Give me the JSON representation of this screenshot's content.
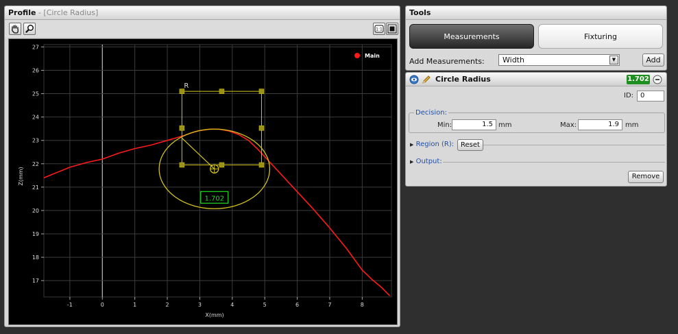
{
  "profile": {
    "title": "Profile",
    "subtitle": " - [Circle Radius]"
  },
  "chart_data": {
    "type": "line",
    "xlabel": "X(mm)",
    "ylabel": "Z(mm)",
    "xlim": [
      -1.8,
      8.9
    ],
    "ylim": [
      16.3,
      27.1
    ],
    "xticks": [
      "-1",
      "0",
      "1",
      "2",
      "3",
      "4",
      "5",
      "6",
      "7",
      "8"
    ],
    "yticks": [
      "17",
      "18",
      "19",
      "20",
      "21",
      "22",
      "23",
      "24",
      "25",
      "26",
      "27"
    ],
    "grid": true,
    "legend": "top-right",
    "series": [
      {
        "name": "Main",
        "color": "#ff1a1a",
        "points": [
          [
            -1.8,
            21.4
          ],
          [
            -1.0,
            21.85
          ],
          [
            -0.5,
            22.05
          ],
          [
            0.0,
            22.2
          ],
          [
            0.5,
            22.45
          ],
          [
            1.0,
            22.65
          ],
          [
            1.5,
            22.8
          ],
          [
            2.0,
            23.0
          ],
          [
            2.5,
            23.2
          ],
          [
            2.8,
            23.35
          ],
          [
            3.0,
            23.42
          ],
          [
            3.3,
            23.48
          ],
          [
            3.6,
            23.48
          ],
          [
            3.9,
            23.4
          ],
          [
            4.2,
            23.25
          ],
          [
            4.5,
            23.0
          ],
          [
            4.8,
            22.6
          ],
          [
            5.0,
            22.3
          ],
          [
            5.5,
            21.55
          ],
          [
            6.0,
            20.8
          ],
          [
            6.5,
            20.05
          ],
          [
            7.0,
            19.25
          ],
          [
            7.5,
            18.4
          ],
          [
            8.0,
            17.45
          ],
          [
            8.3,
            17.05
          ],
          [
            8.6,
            16.7
          ],
          [
            8.85,
            16.35
          ]
        ]
      }
    ],
    "overlay": {
      "region_label": "R",
      "region": {
        "x0": 2.45,
        "x1": 4.9,
        "z0": 21.95,
        "z1": 25.1
      },
      "circle": {
        "cx": 3.45,
        "cz": 21.78,
        "r": 1.702
      },
      "value_label": "1.702",
      "overlay_color": "#d4c41a",
      "label_color": "#22dd22"
    }
  },
  "tools": {
    "title": "Tools",
    "tab_measurements": "Measurements",
    "tab_fixturing": "Fixturing",
    "add_label": "Add Measurements:",
    "select_value": "Width",
    "add_button": "Add"
  },
  "measure": {
    "title": "Circle Radius",
    "value": "1.702",
    "id_label": "ID:",
    "id_value": "0",
    "decision_legend": "Decision:",
    "min_label": "Min:",
    "min_value": "1.5",
    "min_unit": "mm",
    "max_label": "Max:",
    "max_value": "1.9",
    "max_unit": "mm",
    "region_label": "Region (R):",
    "reset_button": "Reset",
    "output_label": "Output:",
    "remove_button": "Remove"
  }
}
